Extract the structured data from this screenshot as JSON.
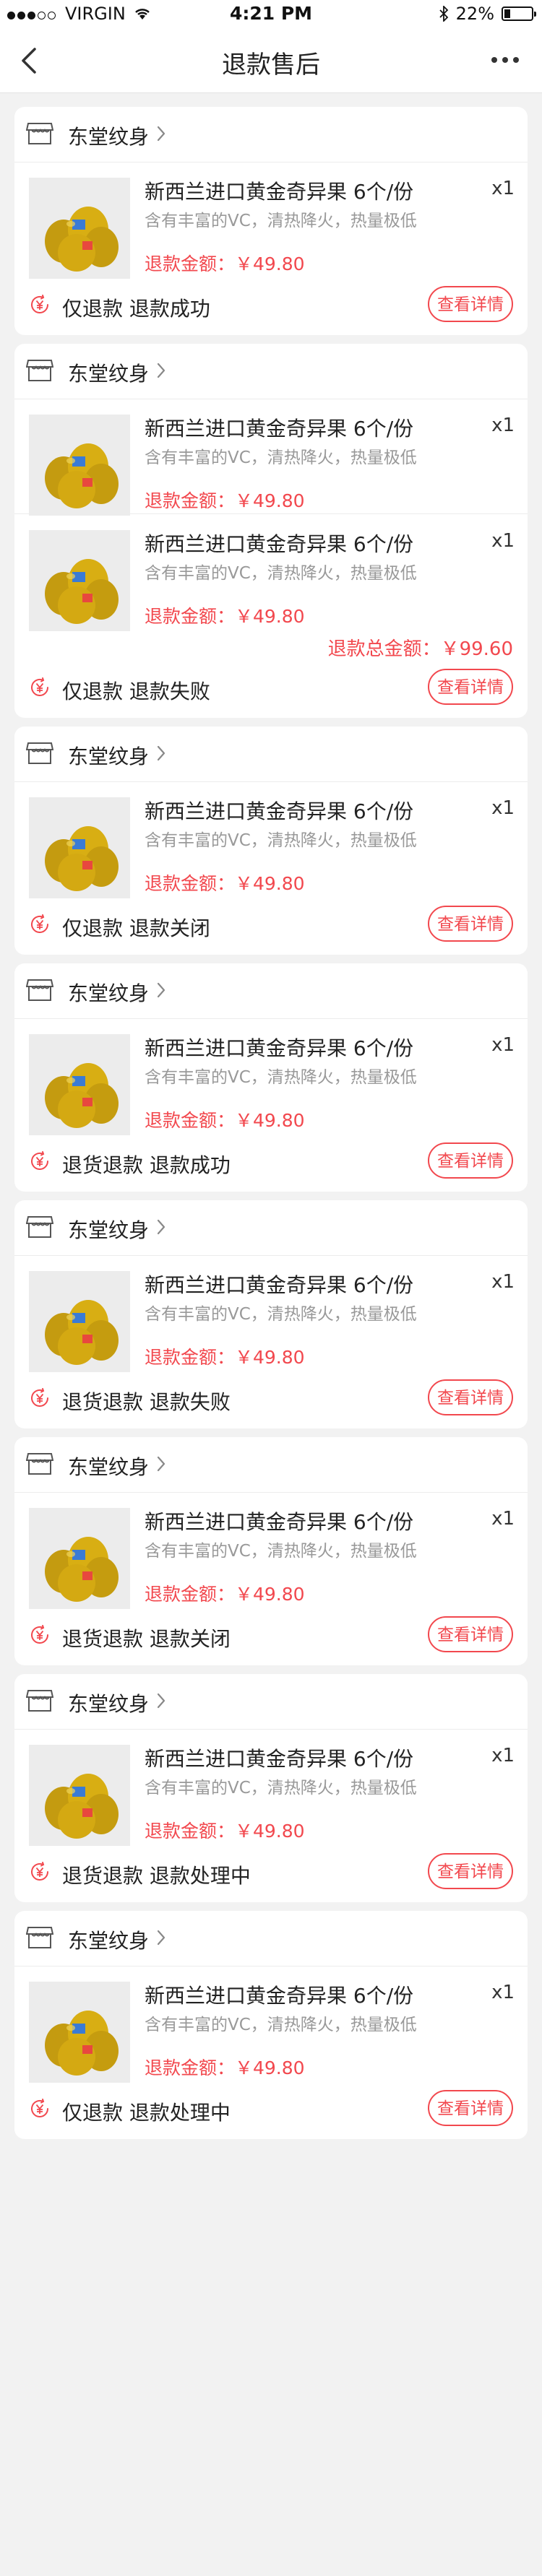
{
  "status_bar": {
    "carrier": "VIRGIN",
    "time": "4:21 PM",
    "battery": "22%",
    "battery_level": 0.22,
    "signal_bars": 5,
    "signal_filled": 3
  },
  "nav": {
    "title": "退款售后",
    "back_icon": "chevron-left-icon",
    "more_icon": "more-dots-icon"
  },
  "colors": {
    "accent": "#f2484e",
    "background": "#f2f2f2"
  },
  "detail_label": "查看详情",
  "orders": [
    {
      "shop": "东堂纹身",
      "items": [
        {
          "name": "新西兰进口黄金奇异果 6个/份",
          "desc": "含有丰富的VC，清热降火，热量极低",
          "qty": "x1",
          "amount": "退款金额：￥49.80"
        }
      ],
      "status": "仅退款  退款成功"
    },
    {
      "shop": "东堂纹身",
      "items": [
        {
          "name": "新西兰进口黄金奇异果 6个/份",
          "desc": "含有丰富的VC，清热降火，热量极低",
          "qty": "x1",
          "amount": "退款金额：￥49.80"
        },
        {
          "name": "新西兰进口黄金奇异果 6个/份",
          "desc": "含有丰富的VC，清热降火，热量极低",
          "qty": "x1",
          "amount": "退款金额：￥49.80"
        }
      ],
      "total": "退款总金额：￥99.60",
      "status": "仅退款  退款失败"
    },
    {
      "shop": "东堂纹身",
      "items": [
        {
          "name": "新西兰进口黄金奇异果 6个/份",
          "desc": "含有丰富的VC，清热降火，热量极低",
          "qty": "x1",
          "amount": "退款金额：￥49.80"
        }
      ],
      "status": "仅退款  退款关闭"
    },
    {
      "shop": "东堂纹身",
      "items": [
        {
          "name": "新西兰进口黄金奇异果 6个/份",
          "desc": "含有丰富的VC，清热降火，热量极低",
          "qty": "x1",
          "amount": "退款金额：￥49.80"
        }
      ],
      "status": "退货退款  退款成功"
    },
    {
      "shop": "东堂纹身",
      "items": [
        {
          "name": "新西兰进口黄金奇异果 6个/份",
          "desc": "含有丰富的VC，清热降火，热量极低",
          "qty": "x1",
          "amount": "退款金额：￥49.80"
        }
      ],
      "status": "退货退款  退款失败"
    },
    {
      "shop": "东堂纹身",
      "items": [
        {
          "name": "新西兰进口黄金奇异果 6个/份",
          "desc": "含有丰富的VC，清热降火，热量极低",
          "qty": "x1",
          "amount": "退款金额：￥49.80"
        }
      ],
      "status": "退货退款  退款关闭"
    },
    {
      "shop": "东堂纹身",
      "items": [
        {
          "name": "新西兰进口黄金奇异果 6个/份",
          "desc": "含有丰富的VC，清热降火，热量极低",
          "qty": "x1",
          "amount": "退款金额：￥49.80"
        }
      ],
      "status": "退货退款  退款处理中"
    },
    {
      "shop": "东堂纹身",
      "items": [
        {
          "name": "新西兰进口黄金奇异果 6个/份",
          "desc": "含有丰富的VC，清热降火，热量极低",
          "qty": "x1",
          "amount": "退款金额：￥49.80"
        }
      ],
      "status": "仅退款  退款处理中"
    }
  ]
}
